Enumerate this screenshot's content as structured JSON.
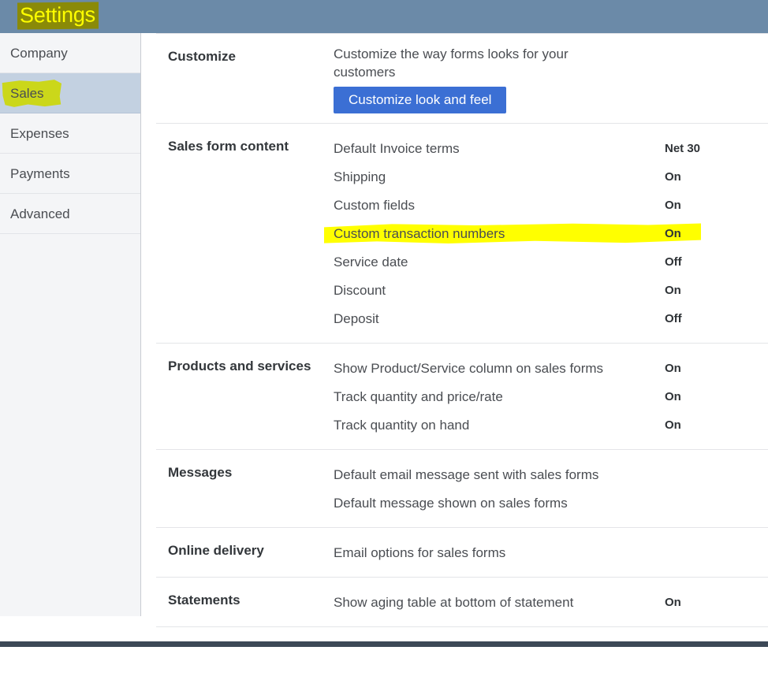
{
  "header": {
    "title": "Settings",
    "title_text_color": "#ffff00",
    "title_highlight_color": "#8a8a08",
    "bar_color": "#6b8aa8"
  },
  "sidebar": {
    "items": [
      {
        "label": "Company",
        "selected": false
      },
      {
        "label": "Sales",
        "selected": true
      },
      {
        "label": "Expenses",
        "selected": false
      },
      {
        "label": "Payments",
        "selected": false
      },
      {
        "label": "Advanced",
        "selected": false
      }
    ],
    "selected_bg_color": "#c3d1e1",
    "marker_color": "#cbd71a"
  },
  "main": {
    "marker_color": "#ffff00",
    "button_color": "#3b6fd4",
    "sections": [
      {
        "label": "Customize",
        "description": "Customize the way forms looks for your customers",
        "button_label": "Customize look and feel"
      },
      {
        "label": "Sales form content",
        "rows": [
          {
            "name": "Default Invoice terms",
            "value": "Net 30",
            "highlighted": false
          },
          {
            "name": "Shipping",
            "value": "On",
            "highlighted": false
          },
          {
            "name": "Custom fields",
            "value": "On",
            "highlighted": false
          },
          {
            "name": "Custom transaction numbers",
            "value": "On",
            "highlighted": true
          },
          {
            "name": "Service date",
            "value": "Off",
            "highlighted": false
          },
          {
            "name": "Discount",
            "value": "On",
            "highlighted": false
          },
          {
            "name": "Deposit",
            "value": "Off",
            "highlighted": false
          }
        ]
      },
      {
        "label": "Products and services",
        "rows": [
          {
            "name": "Show Product/Service column on sales forms",
            "value": "On",
            "highlighted": false
          },
          {
            "name": "Track quantity and price/rate",
            "value": "On",
            "highlighted": false
          },
          {
            "name": "Track quantity on hand",
            "value": "On",
            "highlighted": false
          }
        ]
      },
      {
        "label": "Messages",
        "rows": [
          {
            "name": "Default email message sent with sales forms",
            "value": "",
            "highlighted": false
          },
          {
            "name": "Default message shown on sales forms",
            "value": "",
            "highlighted": false
          }
        ]
      },
      {
        "label": "Online delivery",
        "rows": [
          {
            "name": "Email options for sales forms",
            "value": "",
            "highlighted": false
          }
        ]
      },
      {
        "label": "Statements",
        "rows": [
          {
            "name": "Show aging table at bottom of statement",
            "value": "On",
            "highlighted": false
          }
        ]
      }
    ]
  }
}
